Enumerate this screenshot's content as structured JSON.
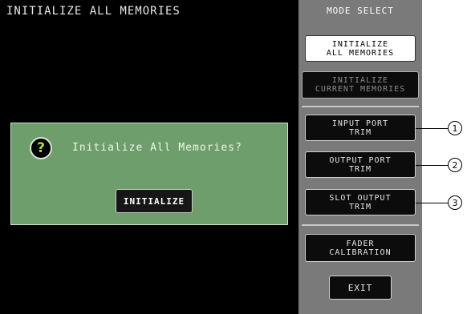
{
  "screen": {
    "title": "INITIALIZE ALL MEMORIES"
  },
  "dialog": {
    "icon": "question-icon",
    "message": "Initialize All Memories?",
    "button_label": "INITIALIZE"
  },
  "mode_select": {
    "title": "MODE SELECT",
    "buttons": [
      {
        "label": "INITIALIZE\nALL MEMORIES",
        "state": "selected"
      },
      {
        "label": "INITIALIZE\nCURRENT MEMORIES",
        "state": "normal"
      },
      {
        "label": "INPUT PORT\nTRIM",
        "state": "normal"
      },
      {
        "label": "OUTPUT PORT\nTRIM",
        "state": "normal"
      },
      {
        "label": "SLOT OUTPUT\nTRIM",
        "state": "normal"
      },
      {
        "label": "FADER\nCALIBRATION",
        "state": "normal"
      },
      {
        "label": "EXIT",
        "state": "normal"
      }
    ]
  },
  "callouts": [
    "1",
    "2",
    "3"
  ],
  "colors": {
    "screen_bg": "#000000",
    "dialog_bg": "#6e9e6b",
    "panel_bg": "#7a7a7a",
    "icon_accent": "#b8e020"
  }
}
